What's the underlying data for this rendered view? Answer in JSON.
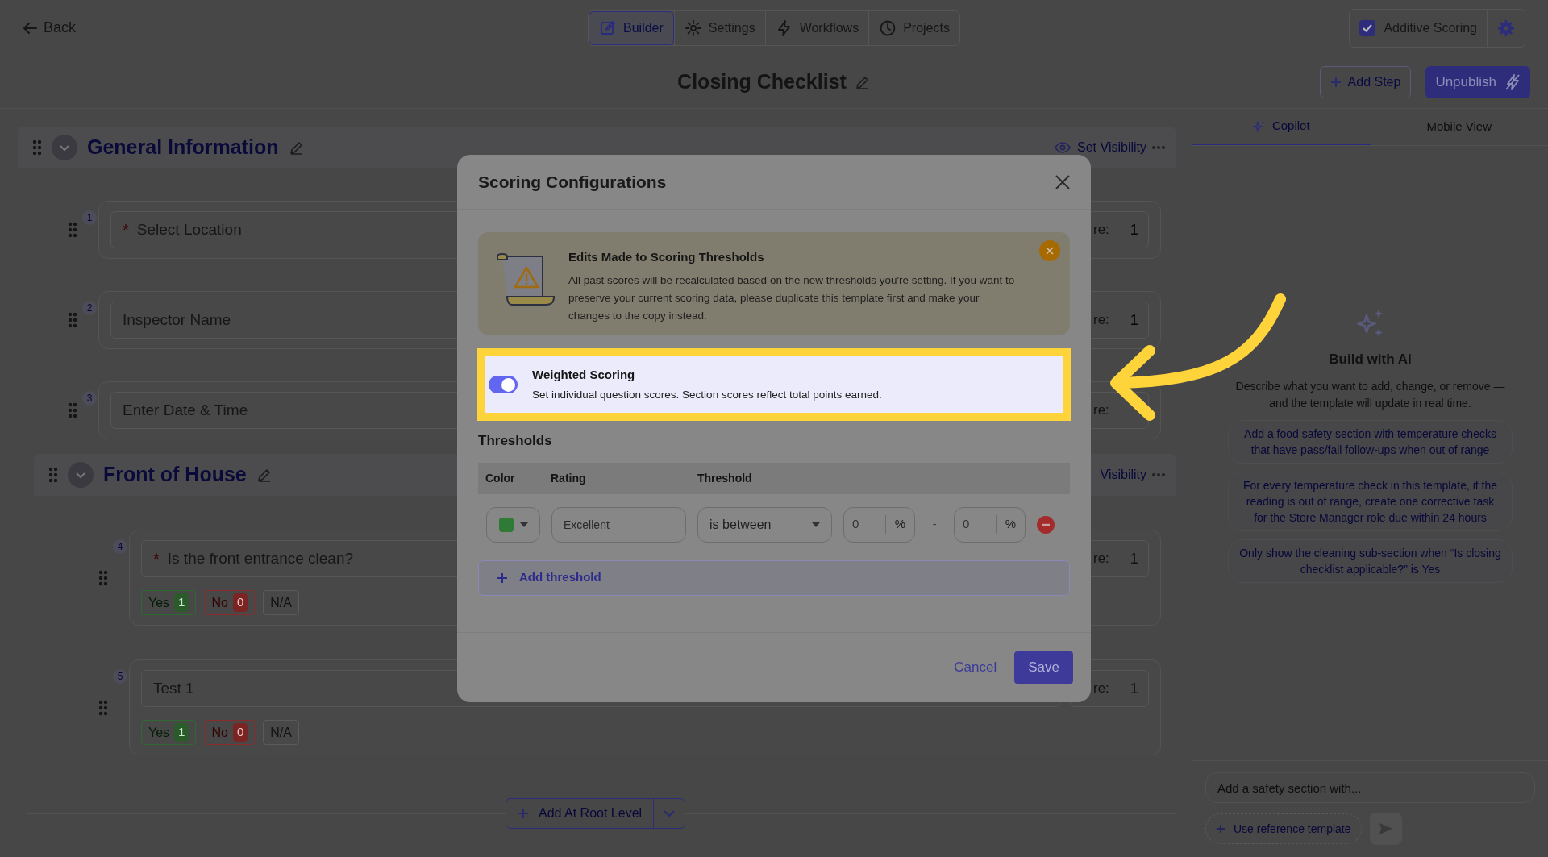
{
  "top_bar": {
    "back": "Back",
    "tabs": [
      {
        "label": "Builder",
        "selected": true
      },
      {
        "label": "Settings",
        "selected": false
      },
      {
        "label": "Workflows",
        "selected": false
      },
      {
        "label": "Projects",
        "selected": false
      }
    ],
    "additive_scoring": {
      "label": "Additive Scoring",
      "checked": true
    }
  },
  "header": {
    "title": "Closing Checklist",
    "add_step": "Add Step",
    "unpublish": "Unpublish"
  },
  "sections": [
    {
      "title": "General Information",
      "visibility": "Set Visibility",
      "questions": [
        {
          "number": "1",
          "label": "Select Location",
          "required_mark": "*",
          "score_label": "re:",
          "score": "1"
        },
        {
          "number": "2",
          "label": "Inspector Name",
          "score_label": "re:",
          "score": "1"
        },
        {
          "number": "3",
          "label": "Enter Date & Time",
          "score_label": "re:"
        }
      ]
    },
    {
      "title": "Front of House",
      "visibility": "Visibility",
      "questions": [
        {
          "number": "4",
          "label": "Is the front entrance clean?",
          "required_mark": "*",
          "score_label": "re:",
          "score": "1",
          "answers": [
            {
              "label": "Yes",
              "score": "1",
              "kind": "pass"
            },
            {
              "label": "No",
              "score": "0",
              "kind": "fail"
            },
            {
              "label": "N/A",
              "kind": "na"
            }
          ]
        },
        {
          "number": "5",
          "label": "Test 1",
          "score_label": "re:",
          "score": "1",
          "answers": [
            {
              "label": "Yes",
              "score": "1",
              "kind": "pass"
            },
            {
              "label": "No",
              "score": "0",
              "kind": "fail"
            },
            {
              "label": "N/A",
              "kind": "na"
            }
          ]
        }
      ]
    }
  ],
  "add_root": "Add At Root Level",
  "side_panel": {
    "tabs": [
      {
        "label": "Copilot",
        "selected": true
      },
      {
        "label": "Mobile View",
        "selected": false
      }
    ],
    "heading": "Build with AI",
    "description": "Describe what you want to add, change, or remove — and the template will update in real time.",
    "suggestions": [
      "Add a food safety section with temperature checks that have pass/fail follow-ups when out of range",
      "For every temperature check in this template, if the reading is out of range, create one corrective task for the Store Manager role due within 24 hours",
      "Only show the cleaning sub-section when “Is closing checklist applicable?” is Yes"
    ],
    "input": {
      "placeholder": "Add a safety section with..."
    },
    "reference_button": "Use reference template"
  },
  "modal": {
    "title": "Scoring Configurations",
    "warning": {
      "title": "Edits Made to Scoring Thresholds",
      "body": "All past scores will be recalculated based on the new thresholds you're setting. If you want to preserve your current scoring data, please duplicate this template first and make your changes to the copy instead."
    },
    "weighted": {
      "title": "Weighted Scoring",
      "description": "Set individual question scores. Section scores reflect total points earned.",
      "on": true
    },
    "thresholds": {
      "heading": "Thresholds",
      "columns": [
        "Color",
        "Rating",
        "Threshold"
      ],
      "rows": [
        {
          "color": "#2f7a34",
          "rating": "Excellent",
          "operator": "is between",
          "min": "0",
          "min_unit": "%",
          "separator": "-",
          "max": "0",
          "max_unit": "%"
        }
      ],
      "add": "Add threshold"
    },
    "cancel": "Cancel",
    "save": "Save"
  }
}
